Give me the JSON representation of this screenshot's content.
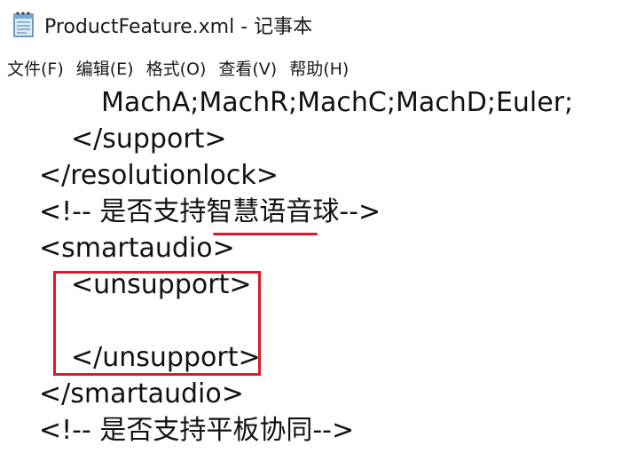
{
  "window": {
    "title": "ProductFeature.xml - 记事本",
    "icon": "notepad-icon"
  },
  "menu": {
    "items": [
      {
        "label": "文件(F)"
      },
      {
        "label": "编辑(E)"
      },
      {
        "label": "格式(O)"
      },
      {
        "label": "查看(V)"
      },
      {
        "label": "帮助(H)"
      }
    ]
  },
  "editor": {
    "lines": [
      "MachA;MachR;MachC;MachD;Euler;",
      "</support>",
      "</resolutionlock>",
      "<!-- 是否支持智慧语音球-->",
      "<smartaudio>",
      "<unsupport>",
      "",
      "</unsupport>",
      "</smartaudio>",
      "<!-- 是否支持平板协同-->"
    ]
  },
  "annotations": {
    "color": "#e0192a"
  }
}
